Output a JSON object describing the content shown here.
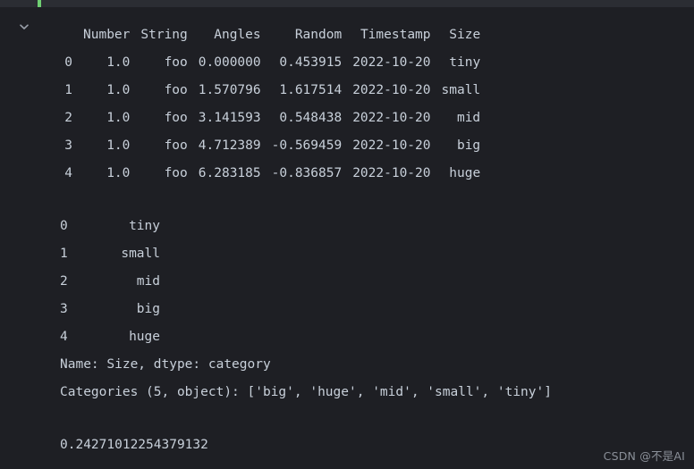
{
  "window": {
    "background_color": "#1e1f24",
    "top_strip_color": "#2b2d33",
    "text_color": "#c8d0da",
    "execution_marker_color": "#6fcf72"
  },
  "gutter": {
    "collapse_icon": "chevron-down-icon"
  },
  "outputs": {
    "dataframe": {
      "columns": [
        "Number",
        "String",
        "Angles",
        "Random",
        "Timestamp",
        "Size"
      ],
      "index": [
        "0",
        "1",
        "2",
        "3",
        "4"
      ],
      "rows": [
        [
          "1.0",
          "foo",
          "0.000000",
          "0.453915",
          "2022-10-20",
          "tiny"
        ],
        [
          "1.0",
          "foo",
          "1.570796",
          "1.617514",
          "2022-10-20",
          "small"
        ],
        [
          "1.0",
          "foo",
          "3.141593",
          "0.548438",
          "2022-10-20",
          "mid"
        ],
        [
          "1.0",
          "foo",
          "4.712389",
          "-0.569459",
          "2022-10-20",
          "big"
        ],
        [
          "1.0",
          "foo",
          "6.283185",
          "-0.836857",
          "2022-10-20",
          "huge"
        ]
      ]
    },
    "series": {
      "index": [
        "0",
        "1",
        "2",
        "3",
        "4"
      ],
      "values": [
        "tiny",
        "small",
        "mid",
        "big",
        "huge"
      ],
      "name_line": "Name: Size, dtype: category",
      "categories_line": "Categories (5, object): ['big', 'huge', 'mid', 'small', 'tiny']"
    },
    "scalar": {
      "value": "0.24271012254379132"
    }
  },
  "watermark": {
    "text": "CSDN @不是AI"
  }
}
